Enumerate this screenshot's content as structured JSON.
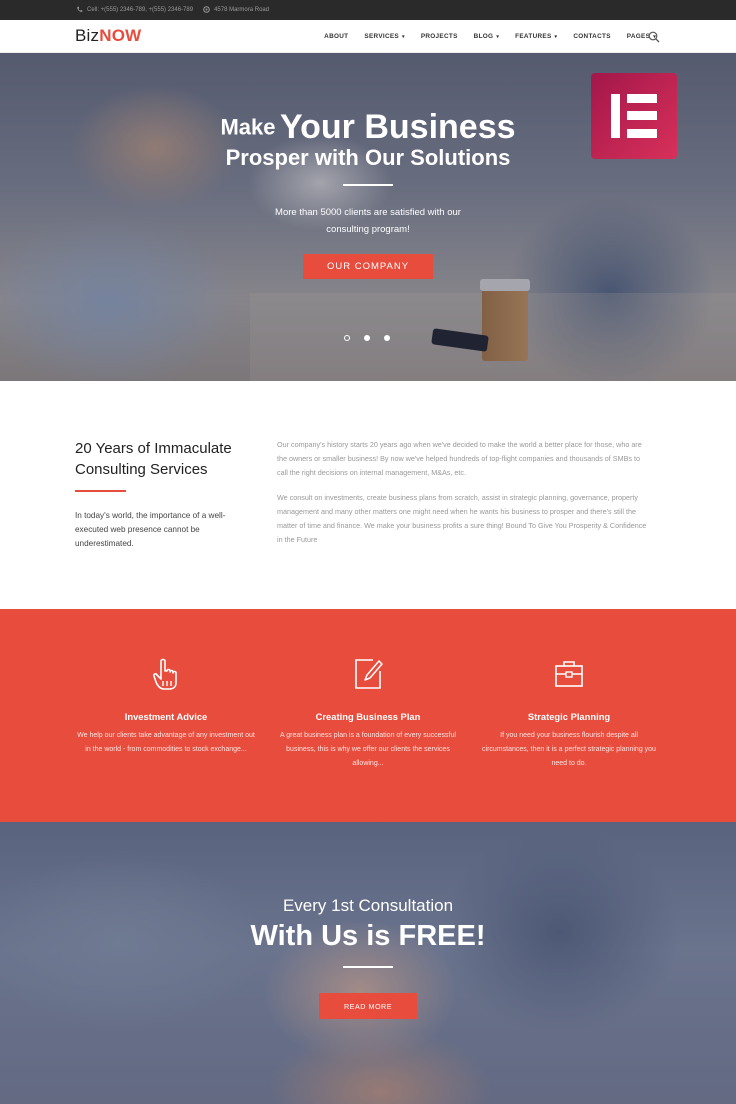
{
  "topbar": {
    "phone": "Cell: +(555) 2346-789, +(555) 2346-789",
    "address": "4578 Marmora Road"
  },
  "header": {
    "logo_prefix": "Biz",
    "logo_suffix": "NOW",
    "menu": [
      {
        "label": "ABOUT",
        "caret": false
      },
      {
        "label": "SERVICES",
        "caret": true
      },
      {
        "label": "PROJECTS",
        "caret": false
      },
      {
        "label": "BLOG",
        "caret": true
      },
      {
        "label": "FEATURES",
        "caret": true
      },
      {
        "label": "CONTACTS",
        "caret": false
      },
      {
        "label": "PAGES",
        "caret": true
      }
    ]
  },
  "hero": {
    "title_small": "Make",
    "title_big": "Your Business",
    "title_line2": "Prosper with Our Solutions",
    "subtitle": "More than 5000 clients are satisfied with our consulting program!",
    "button": "OUR COMPANY",
    "slides": 3,
    "active_slide": 1
  },
  "about": {
    "title": "20 Years of Immaculate Consulting Services",
    "left_text": "In today's world, the importance of a well-executed web presence cannot be underestimated.",
    "p1": "Our company's history starts 20 years ago when we've decided to make the world a better place for those, who are the owners or smaller business! By now we've helped hundreds of top-flight companies and thousands of SMBs to call the right decisions on internal management, M&As, etc.",
    "p2": "We consult on investments, create business plans from scratch, assist in strategic planning, governance, property management and many other matters one might need when he wants his business to prosper and there's still the matter of time and finance. We make your business profits a sure thing! Bound To Give You Prosperity & Confidence in the Future"
  },
  "services": [
    {
      "icon": "hand-pointer-icon",
      "title": "Investment Advice",
      "text": "We help our clients take advantage of any investment out in the world - from commodities to stock exchange..."
    },
    {
      "icon": "edit-document-icon",
      "title": "Creating Business Plan",
      "text": "A great business plan is a foundation of every successful business, this is why we offer our clients the services allowing..."
    },
    {
      "icon": "briefcase-icon",
      "title": "Strategic Planning",
      "text": "If you need your business flourish despite all circumstances, then it is a perfect strategic planning you need to do."
    }
  ],
  "cta": {
    "line1": "Every 1st Consultation",
    "line2": "With Us is FREE!",
    "button": "READ MORE"
  },
  "colors": {
    "accent": "#e84c3d",
    "topbar": "#2a2a2a",
    "elementor_badge": "#c2245a"
  }
}
